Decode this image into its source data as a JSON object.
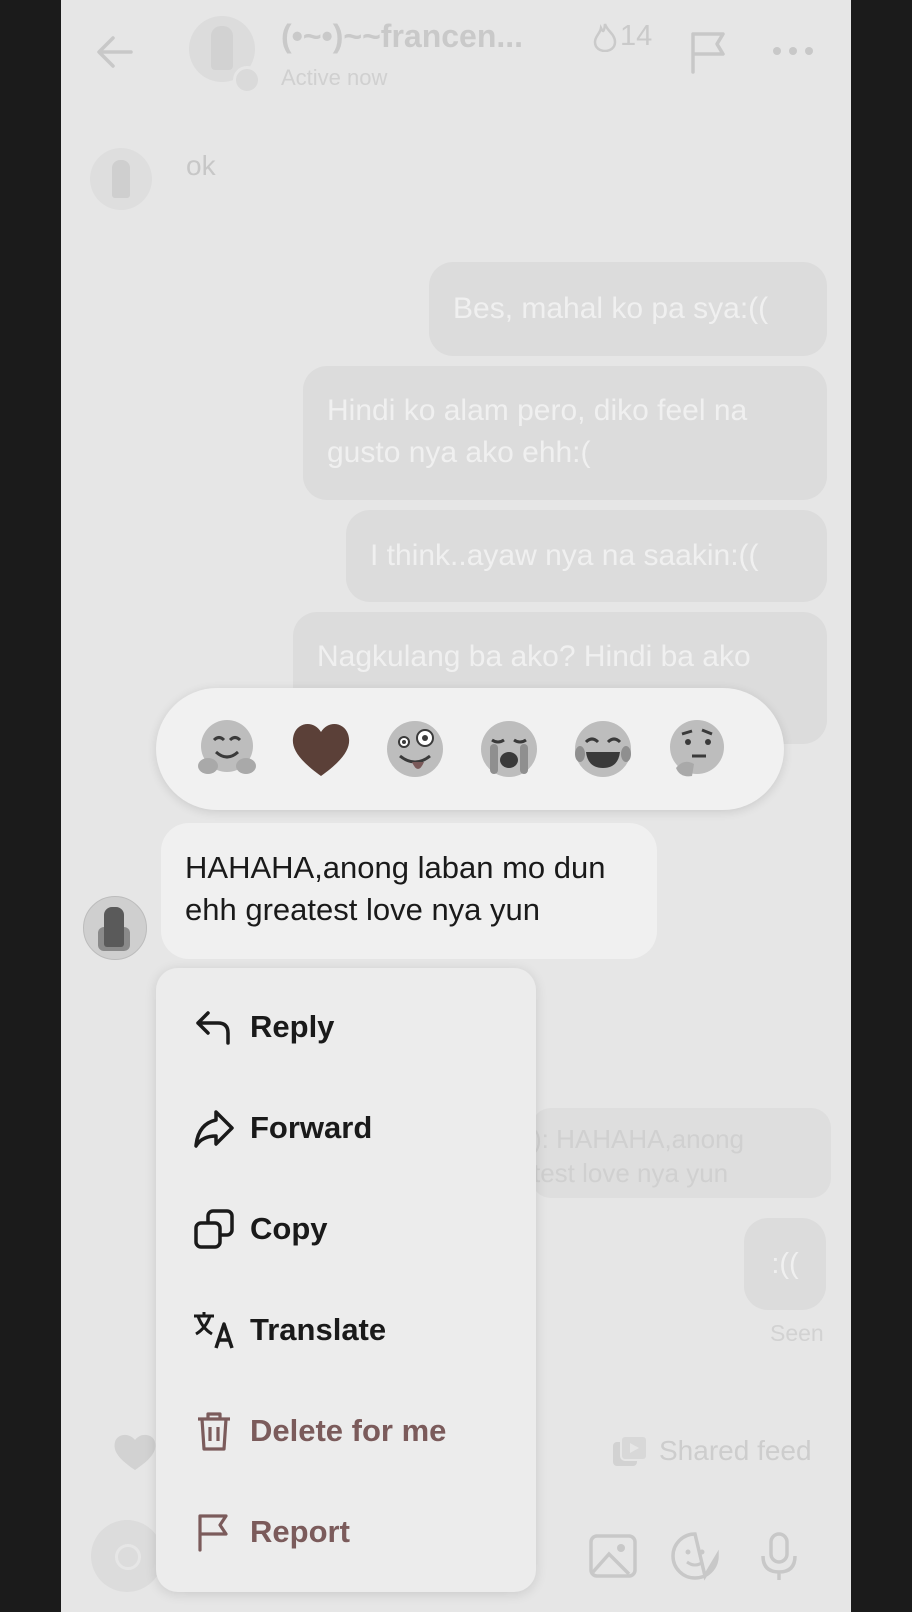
{
  "header": {
    "contact_name": "(•~•)~~francen...",
    "streak_count": "14",
    "status": "Active now"
  },
  "messages": {
    "incoming_ok": "ok",
    "out_1": "Bes, mahal ko pa sya:((",
    "out_2_line1": "Hindi ko alam pero, diko feel na",
    "out_2_line2": "gusto nya ako ehh:(",
    "out_3": "I think..ayaw nya na saakin:((",
    "out_4": "Nagkulang ba ako? Hindi ba ako",
    "highlighted_line1": "HAHAHA,anong laban mo dun",
    "highlighted_line2": "ehh greatest love nya yun",
    "reply_preview_line1": "): HAHAHA,anong",
    "reply_preview_line2": "test love nya yun",
    "out_5": ":((",
    "seen": "Seen"
  },
  "reactions": [
    "hugging-face",
    "brown-heart",
    "zany-face",
    "loudly-crying-face",
    "tears-of-joy-face",
    "thinking-face"
  ],
  "shared_feed_label": "Shared feed",
  "context_menu": {
    "reply": "Reply",
    "forward": "Forward",
    "copy": "Copy",
    "translate": "Translate",
    "delete": "Delete for me",
    "report": "Report"
  },
  "colors": {
    "dim_background": "#e6e6e6",
    "menu_background": "#ececec",
    "danger_text": "#7b5b5b",
    "outgoing_bubble": "#dcdcdc"
  }
}
